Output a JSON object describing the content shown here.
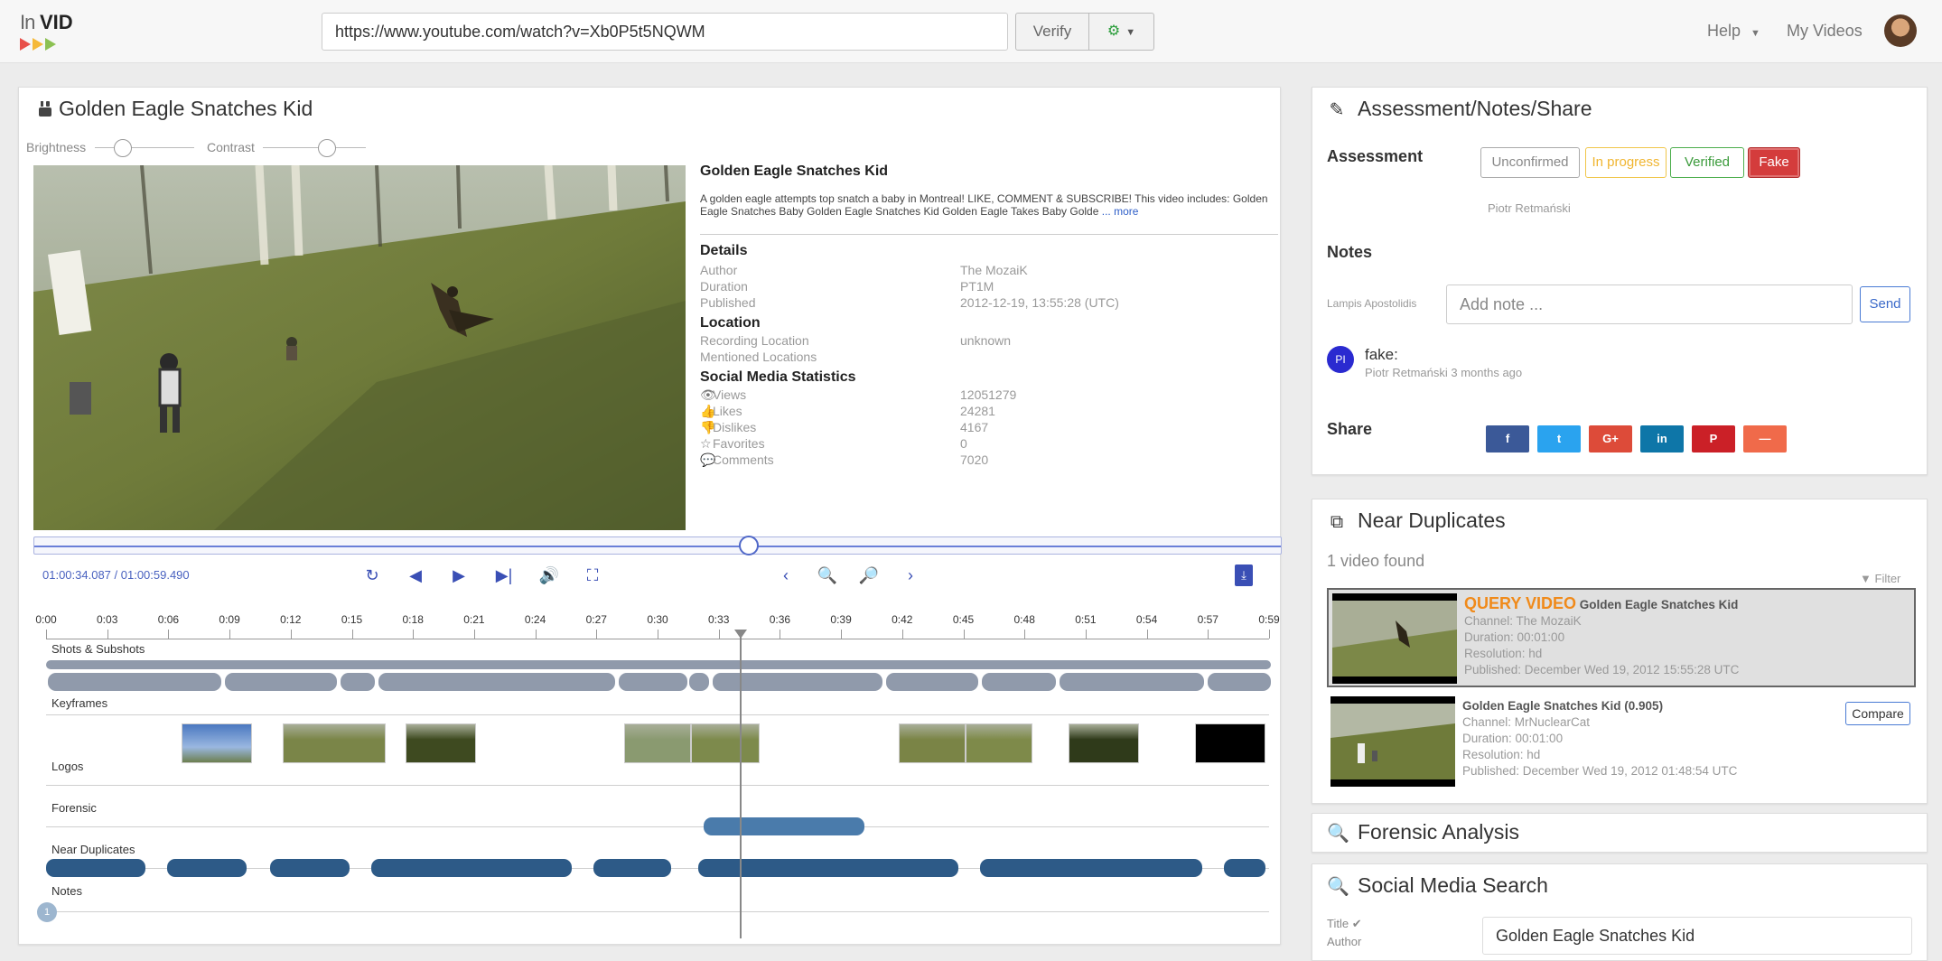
{
  "app": {
    "logo_in": "In",
    "logo_vid": "VID"
  },
  "topbar": {
    "url": "https://www.youtube.com/watch?v=Xb0P5t5NQWM",
    "verify_label": "Verify",
    "help_label": "Help",
    "my_videos_label": "My Videos"
  },
  "video": {
    "title": "Golden Eagle Snatches Kid",
    "brightness_label": "Brightness",
    "contrast_label": "Contrast",
    "brightness_level": 0.28,
    "contrast_level": 0.62,
    "description_title": "Golden Eagle Snatches Kid",
    "description": "A golden eagle attempts top snatch a baby in Montreal! LIKE, COMMENT & SUBSCRIBE! This video includes: Golden Eagle Snatches Baby Golden Eagle Snatches Kid Golden Eagle Takes Baby Golde",
    "description_more": "... more",
    "details_title": "Details",
    "details": [
      {
        "label": "Author",
        "value": "The MozaiK"
      },
      {
        "label": "Duration",
        "value": "PT1M"
      },
      {
        "label": "Published",
        "value": "2012-12-19, 13:55:28 (UTC)"
      }
    ],
    "location_title": "Location",
    "location": [
      {
        "label": "Recording Location",
        "value": "unknown"
      },
      {
        "label": "Mentioned Locations",
        "value": ""
      }
    ],
    "stats_title": "Social Media Statistics",
    "stats": [
      {
        "icon": "eye-icon",
        "glyph": "👁",
        "label": "Views",
        "value": "12051279"
      },
      {
        "icon": "thumbs-up-icon",
        "glyph": "👍",
        "label": "Likes",
        "value": "24281"
      },
      {
        "icon": "thumbs-down-icon",
        "glyph": "👎",
        "label": "Dislikes",
        "value": "4167"
      },
      {
        "icon": "star-icon",
        "glyph": "☆",
        "label": "Favorites",
        "value": "0"
      },
      {
        "icon": "comments-icon",
        "glyph": "💬",
        "label": "Comments",
        "value": "7020"
      }
    ],
    "time_readout": "01:00:34.087 / 01:00:59.490",
    "progress": 0.573
  },
  "timeline": {
    "ticks": [
      "0:00",
      "0:03",
      "0:06",
      "0:09",
      "0:12",
      "0:15",
      "0:18",
      "0:21",
      "0:24",
      "0:27",
      "0:30",
      "0:33",
      "0:36",
      "0:39",
      "0:42",
      "0:45",
      "0:48",
      "0:51",
      "0:54",
      "0:57",
      "0:59"
    ],
    "tracks": {
      "shots": "Shots & Subshots",
      "keyframes": "Keyframes",
      "logos": "Logos",
      "forensic": "Forensic",
      "near_duplicates": "Near Duplicates",
      "notes": "Notes"
    },
    "note_marker": "1"
  },
  "assessment": {
    "title": "Assessment/Notes/Share",
    "assessment_label": "Assessment",
    "options": [
      "Unconfirmed",
      "In progress",
      "Verified",
      "Fake"
    ],
    "selected": "Fake",
    "assessor": "Piotr Retmański",
    "notes_label": "Notes",
    "note_author": "Lampis Apostolidis",
    "note_placeholder": "Add note ...",
    "send_label": "Send",
    "existing_note": {
      "initials": "PI",
      "text": "fake:",
      "meta": "Piotr Retmański 3 months ago"
    },
    "share_label": "Share",
    "share": [
      {
        "name": "facebook",
        "glyph": "f",
        "color": "#3b5998"
      },
      {
        "name": "twitter",
        "glyph": "t",
        "color": "#2aa3ef"
      },
      {
        "name": "google-plus",
        "glyph": "G+",
        "color": "#dd4b39"
      },
      {
        "name": "linkedin",
        "glyph": "in",
        "color": "#0e76a8"
      },
      {
        "name": "pinterest",
        "glyph": "P",
        "color": "#cb2027"
      },
      {
        "name": "more",
        "glyph": "—",
        "color": "#f06a4a"
      }
    ]
  },
  "near_duplicates": {
    "title": "Near Duplicates",
    "found_text": "1 video found",
    "filter_label": "Filter",
    "query": {
      "tag": "QUERY VIDEO",
      "title": "Golden Eagle Snatches Kid",
      "channel": "Channel: The MozaiK",
      "duration": "Duration: 00:01:00",
      "resolution": "Resolution: hd",
      "published": "Published: December Wed 19, 2012 15:55:28 UTC"
    },
    "result": {
      "title": "Golden Eagle Snatches Kid (0.905)",
      "channel": "Channel: MrNuclearCat",
      "duration": "Duration: 00:01:00",
      "resolution": "Resolution: hd",
      "published": "Published: December Wed 19, 2012 01:48:54 UTC",
      "compare_label": "Compare"
    }
  },
  "forensic": {
    "title": "Forensic Analysis"
  },
  "social_search": {
    "title": "Social Media Search",
    "title_label": "Title ✔",
    "author_label": "Author",
    "query_value": "Golden Eagle Snatches Kid"
  },
  "colors": {
    "accent": "#3a4fb5",
    "shots": "#909aab",
    "near_duplicates": "#2d5a87",
    "forensic": "#4a7bab",
    "fake": "#d43c3c"
  }
}
